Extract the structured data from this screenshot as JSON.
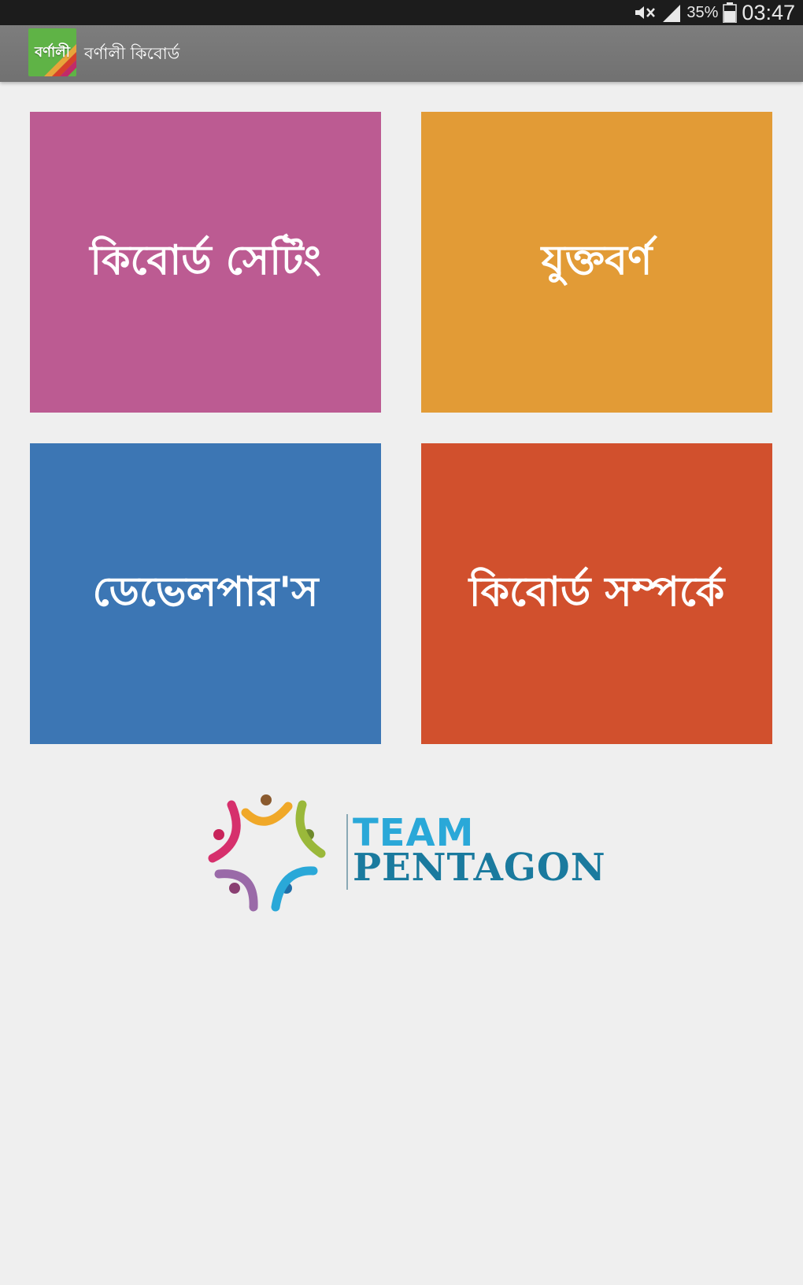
{
  "status_bar": {
    "battery_percent": "35%",
    "time": "03:47",
    "icons": [
      "mute-icon",
      "signal-icon",
      "battery-icon"
    ]
  },
  "action_bar": {
    "logo_text": "বর্ণালী",
    "title": "বর্ণালী কিবোর্ড"
  },
  "tiles": [
    {
      "label": "কিবোর্ড সেটিং",
      "color": "#bc5b92"
    },
    {
      "label": "যুক্তবর্ণ",
      "color": "#e29b36"
    },
    {
      "label": "ডেভেলপার'স",
      "color": "#3c76b4"
    },
    {
      "label": "কিবোর্ড  সম্পর্কে",
      "color": "#d1502d"
    }
  ],
  "team_logo": {
    "line1": "TEAM",
    "line2": "PENTAGON",
    "colors": [
      "#2aa8d8",
      "#1a7a9e"
    ]
  }
}
